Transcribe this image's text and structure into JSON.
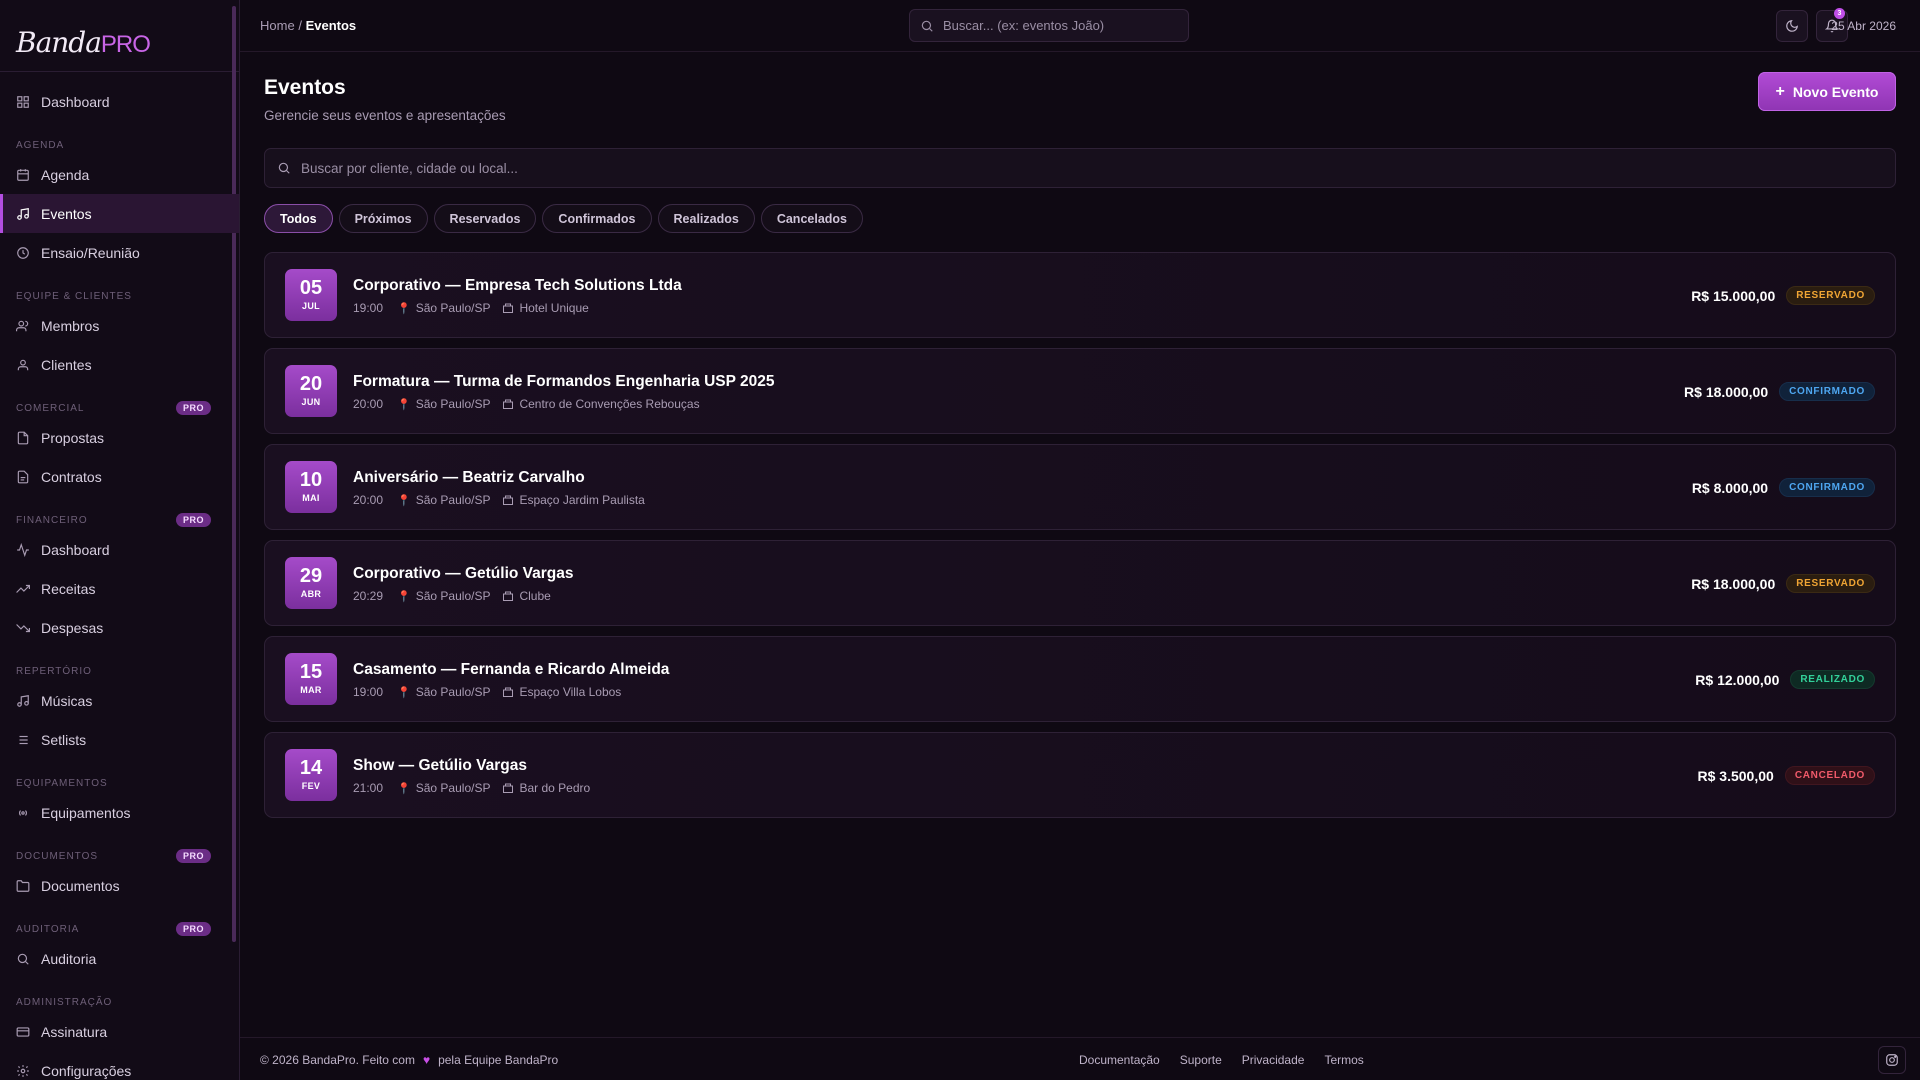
{
  "brand": {
    "name": "Banda",
    "suffix": "PRO"
  },
  "sidebar": {
    "top_item": {
      "label": "Dashboard",
      "icon": "dashboard-icon"
    },
    "groups": [
      {
        "label": "AGENDA",
        "pro": false,
        "items": [
          {
            "label": "Agenda",
            "icon": "calendar-icon",
            "active": false
          },
          {
            "label": "Eventos",
            "icon": "music-note-icon",
            "active": true
          },
          {
            "label": "Ensaio/Reunião",
            "icon": "clock-icon",
            "active": false
          }
        ]
      },
      {
        "label": "EQUIPE & CLIENTES",
        "pro": false,
        "items": [
          {
            "label": "Membros",
            "icon": "users-icon"
          },
          {
            "label": "Clientes",
            "icon": "user-icon"
          }
        ]
      },
      {
        "label": "COMERCIAL",
        "pro": true,
        "items": [
          {
            "label": "Propostas",
            "icon": "file-icon"
          },
          {
            "label": "Contratos",
            "icon": "file-text-icon"
          }
        ]
      },
      {
        "label": "FINANCEIRO",
        "pro": true,
        "items": [
          {
            "label": "Dashboard",
            "icon": "activity-icon"
          },
          {
            "label": "Receitas",
            "icon": "trending-up-icon"
          },
          {
            "label": "Despesas",
            "icon": "trending-down-icon"
          }
        ]
      },
      {
        "label": "REPERTÓRIO",
        "pro": false,
        "items": [
          {
            "label": "Músicas",
            "icon": "music-icon"
          },
          {
            "label": "Setlists",
            "icon": "list-icon"
          }
        ]
      },
      {
        "label": "EQUIPAMENTOS",
        "pro": false,
        "items": [
          {
            "label": "Equipamentos",
            "icon": "radio-icon"
          }
        ]
      },
      {
        "label": "DOCUMENTOS",
        "pro": true,
        "items": [
          {
            "label": "Documentos",
            "icon": "folder-icon"
          }
        ]
      },
      {
        "label": "AUDITORIA",
        "pro": true,
        "items": [
          {
            "label": "Auditoria",
            "icon": "search-icon"
          }
        ]
      },
      {
        "label": "ADMINISTRAÇÃO",
        "pro": false,
        "items": [
          {
            "label": "Assinatura",
            "icon": "credit-card-icon"
          },
          {
            "label": "Configurações",
            "icon": "gear-icon"
          }
        ]
      }
    ],
    "pro_badge": "PRO"
  },
  "topbar": {
    "breadcrumb_home": "Home",
    "breadcrumb_sep": "/",
    "breadcrumb_current": "Eventos",
    "search_placeholder": "Buscar... (ex: eventos João)",
    "notification_count": "3",
    "date": "25 Abr 2026"
  },
  "page": {
    "title": "Eventos",
    "subtitle": "Gerencie seus eventos e apresentações",
    "new_button": "Novo Evento",
    "search_placeholder": "Buscar por cliente, cidade ou local...",
    "filters": [
      "Todos",
      "Próximos",
      "Reservados",
      "Confirmados",
      "Realizados",
      "Cancelados"
    ],
    "active_filter": "Todos"
  },
  "events": [
    {
      "day": "05",
      "month": "JUL",
      "title": "Corporativo — Empresa Tech Solutions Ltda",
      "time": "19:00",
      "city": "São Paulo/SP",
      "venue": "Hotel Unique",
      "price": "R$ 15.000,00",
      "status": "RESERVADO",
      "status_class": "st-reservado"
    },
    {
      "day": "20",
      "month": "JUN",
      "title": "Formatura — Turma de Formandos Engenharia USP 2025",
      "time": "20:00",
      "city": "São Paulo/SP",
      "venue": "Centro de Convenções Rebouças",
      "price": "R$ 18.000,00",
      "status": "CONFIRMADO",
      "status_class": "st-confirmado"
    },
    {
      "day": "10",
      "month": "MAI",
      "title": "Aniversário — Beatriz Carvalho",
      "time": "20:00",
      "city": "São Paulo/SP",
      "venue": "Espaço Jardim Paulista",
      "price": "R$ 8.000,00",
      "status": "CONFIRMADO",
      "status_class": "st-confirmado"
    },
    {
      "day": "29",
      "month": "ABR",
      "title": "Corporativo — Getúlio Vargas",
      "time": "20:29",
      "city": "São Paulo/SP",
      "venue": "Clube",
      "price": "R$ 18.000,00",
      "status": "RESERVADO",
      "status_class": "st-reservado"
    },
    {
      "day": "15",
      "month": "MAR",
      "title": "Casamento — Fernanda e Ricardo Almeida",
      "time": "19:00",
      "city": "São Paulo/SP",
      "venue": "Espaço Villa Lobos",
      "price": "R$ 12.000,00",
      "status": "REALIZADO",
      "status_class": "st-realizado"
    },
    {
      "day": "14",
      "month": "FEV",
      "title": "Show — Getúlio Vargas",
      "time": "21:00",
      "city": "São Paulo/SP",
      "venue": "Bar do Pedro",
      "price": "R$ 3.500,00",
      "status": "CANCELADO",
      "status_class": "st-cancelado"
    }
  ],
  "footer": {
    "copyright": "© 2026 BandaPro.",
    "made_with": "Feito com",
    "by_team": "pela Equipe BandaPro",
    "links": [
      "Documentação",
      "Suporte",
      "Privacidade",
      "Termos"
    ]
  },
  "colors": {
    "accent": "#b24ee0",
    "background": "#0f0913",
    "reservado": "#f0a534",
    "confirmado": "#4ea6f0",
    "realizado": "#32d19a",
    "cancelado": "#f05a6a"
  }
}
